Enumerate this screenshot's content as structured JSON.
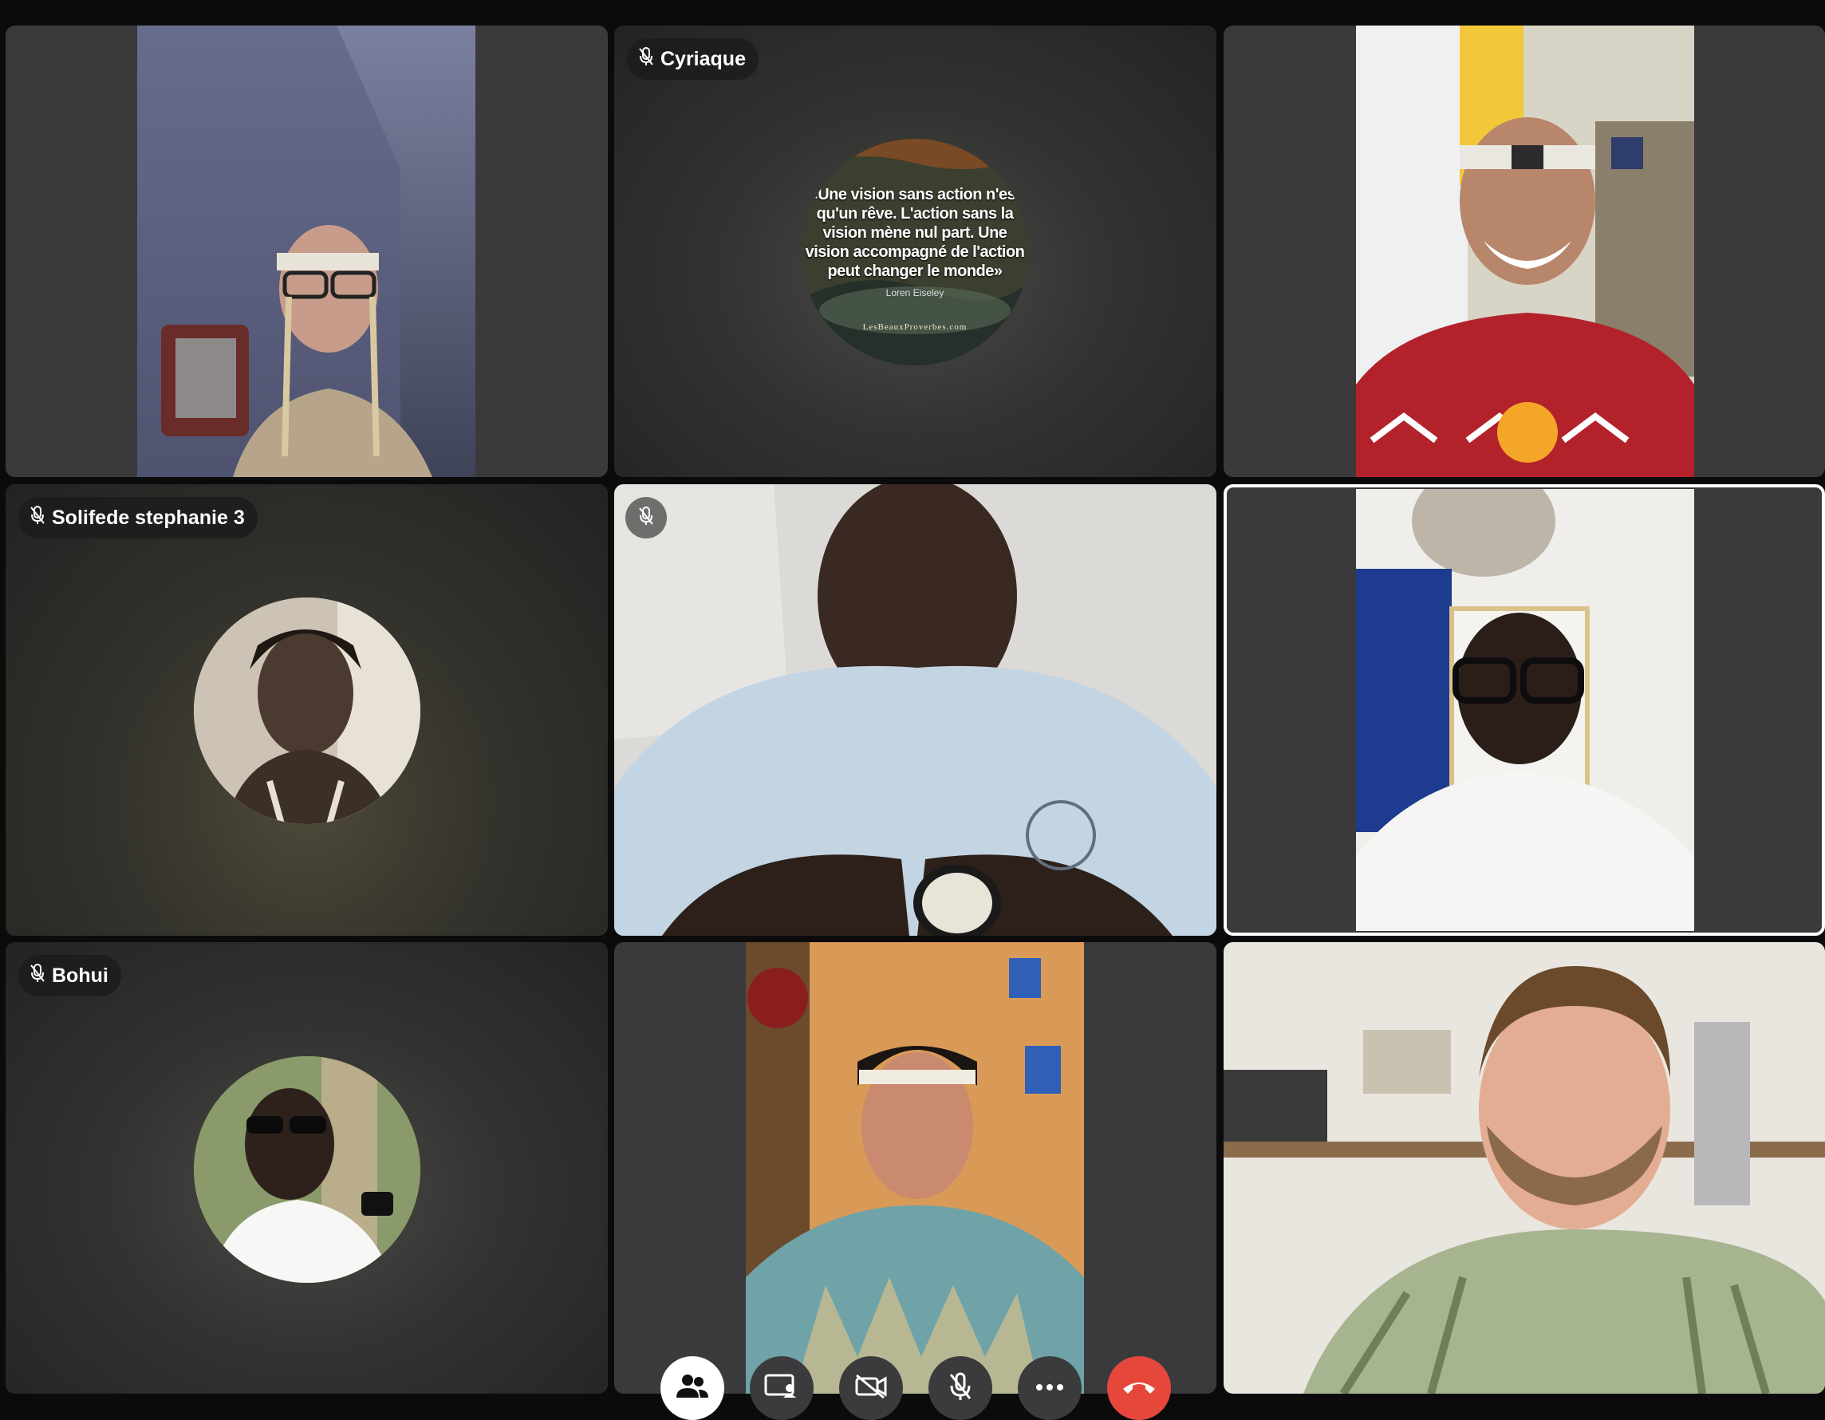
{
  "participants": [
    {
      "name": "",
      "muted": false,
      "video": "on"
    },
    {
      "name": "Cyriaque",
      "muted": true,
      "video": "off"
    },
    {
      "name": "",
      "muted": false,
      "video": "on"
    },
    {
      "name": "Solifede stephanie 3",
      "muted": true,
      "video": "off"
    },
    {
      "name": "",
      "muted": true,
      "video": "on"
    },
    {
      "name": "",
      "muted": false,
      "video": "on",
      "active_speaker": true
    },
    {
      "name": "Bohui",
      "muted": true,
      "video": "off"
    },
    {
      "name": "",
      "muted": false,
      "video": "on"
    },
    {
      "name": "",
      "muted": false,
      "video": "on"
    }
  ],
  "cyriaque_avatar": {
    "quote": "«Une vision sans action n'est qu'un rêve. L'action sans la vision mène nul part. Une vision accompagné de l'action peut changer le monde»",
    "quote_lines": [
      "«Une vision sans action n'est",
      "qu'un rêve. L'action sans la",
      "vision mène nul part. Une",
      "vision accompagné de l'action",
      "peut changer le monde»"
    ],
    "author": "Loren Eiseley",
    "site": "LesBeauxProverbes.com"
  },
  "toolbar": {
    "buttons": [
      "participants-icon",
      "screen-share-icon",
      "camera-off-icon",
      "mic-off-icon",
      "more-icon",
      "end-call-icon"
    ],
    "end_call_color": "#e5483b"
  }
}
